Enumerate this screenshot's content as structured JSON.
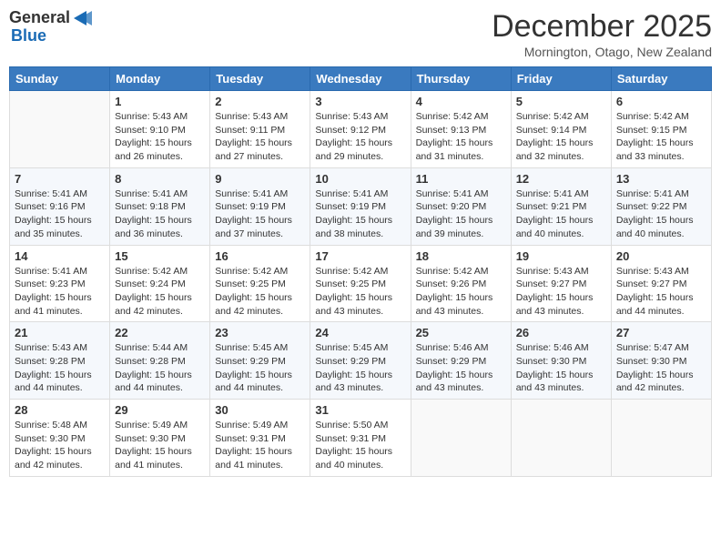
{
  "header": {
    "logo_general": "General",
    "logo_blue": "Blue",
    "month_title": "December 2025",
    "location": "Mornington, Otago, New Zealand"
  },
  "days_of_week": [
    "Sunday",
    "Monday",
    "Tuesday",
    "Wednesday",
    "Thursday",
    "Friday",
    "Saturday"
  ],
  "weeks": [
    [
      {
        "day": "",
        "info": ""
      },
      {
        "day": "1",
        "info": "Sunrise: 5:43 AM\nSunset: 9:10 PM\nDaylight: 15 hours\nand 26 minutes."
      },
      {
        "day": "2",
        "info": "Sunrise: 5:43 AM\nSunset: 9:11 PM\nDaylight: 15 hours\nand 27 minutes."
      },
      {
        "day": "3",
        "info": "Sunrise: 5:43 AM\nSunset: 9:12 PM\nDaylight: 15 hours\nand 29 minutes."
      },
      {
        "day": "4",
        "info": "Sunrise: 5:42 AM\nSunset: 9:13 PM\nDaylight: 15 hours\nand 31 minutes."
      },
      {
        "day": "5",
        "info": "Sunrise: 5:42 AM\nSunset: 9:14 PM\nDaylight: 15 hours\nand 32 minutes."
      },
      {
        "day": "6",
        "info": "Sunrise: 5:42 AM\nSunset: 9:15 PM\nDaylight: 15 hours\nand 33 minutes."
      }
    ],
    [
      {
        "day": "7",
        "info": "Sunrise: 5:41 AM\nSunset: 9:16 PM\nDaylight: 15 hours\nand 35 minutes."
      },
      {
        "day": "8",
        "info": "Sunrise: 5:41 AM\nSunset: 9:18 PM\nDaylight: 15 hours\nand 36 minutes."
      },
      {
        "day": "9",
        "info": "Sunrise: 5:41 AM\nSunset: 9:19 PM\nDaylight: 15 hours\nand 37 minutes."
      },
      {
        "day": "10",
        "info": "Sunrise: 5:41 AM\nSunset: 9:19 PM\nDaylight: 15 hours\nand 38 minutes."
      },
      {
        "day": "11",
        "info": "Sunrise: 5:41 AM\nSunset: 9:20 PM\nDaylight: 15 hours\nand 39 minutes."
      },
      {
        "day": "12",
        "info": "Sunrise: 5:41 AM\nSunset: 9:21 PM\nDaylight: 15 hours\nand 40 minutes."
      },
      {
        "day": "13",
        "info": "Sunrise: 5:41 AM\nSunset: 9:22 PM\nDaylight: 15 hours\nand 40 minutes."
      }
    ],
    [
      {
        "day": "14",
        "info": "Sunrise: 5:41 AM\nSunset: 9:23 PM\nDaylight: 15 hours\nand 41 minutes."
      },
      {
        "day": "15",
        "info": "Sunrise: 5:42 AM\nSunset: 9:24 PM\nDaylight: 15 hours\nand 42 minutes."
      },
      {
        "day": "16",
        "info": "Sunrise: 5:42 AM\nSunset: 9:25 PM\nDaylight: 15 hours\nand 42 minutes."
      },
      {
        "day": "17",
        "info": "Sunrise: 5:42 AM\nSunset: 9:25 PM\nDaylight: 15 hours\nand 43 minutes."
      },
      {
        "day": "18",
        "info": "Sunrise: 5:42 AM\nSunset: 9:26 PM\nDaylight: 15 hours\nand 43 minutes."
      },
      {
        "day": "19",
        "info": "Sunrise: 5:43 AM\nSunset: 9:27 PM\nDaylight: 15 hours\nand 43 minutes."
      },
      {
        "day": "20",
        "info": "Sunrise: 5:43 AM\nSunset: 9:27 PM\nDaylight: 15 hours\nand 44 minutes."
      }
    ],
    [
      {
        "day": "21",
        "info": "Sunrise: 5:43 AM\nSunset: 9:28 PM\nDaylight: 15 hours\nand 44 minutes."
      },
      {
        "day": "22",
        "info": "Sunrise: 5:44 AM\nSunset: 9:28 PM\nDaylight: 15 hours\nand 44 minutes."
      },
      {
        "day": "23",
        "info": "Sunrise: 5:45 AM\nSunset: 9:29 PM\nDaylight: 15 hours\nand 44 minutes."
      },
      {
        "day": "24",
        "info": "Sunrise: 5:45 AM\nSunset: 9:29 PM\nDaylight: 15 hours\nand 43 minutes."
      },
      {
        "day": "25",
        "info": "Sunrise: 5:46 AM\nSunset: 9:29 PM\nDaylight: 15 hours\nand 43 minutes."
      },
      {
        "day": "26",
        "info": "Sunrise: 5:46 AM\nSunset: 9:30 PM\nDaylight: 15 hours\nand 43 minutes."
      },
      {
        "day": "27",
        "info": "Sunrise: 5:47 AM\nSunset: 9:30 PM\nDaylight: 15 hours\nand 42 minutes."
      }
    ],
    [
      {
        "day": "28",
        "info": "Sunrise: 5:48 AM\nSunset: 9:30 PM\nDaylight: 15 hours\nand 42 minutes."
      },
      {
        "day": "29",
        "info": "Sunrise: 5:49 AM\nSunset: 9:30 PM\nDaylight: 15 hours\nand 41 minutes."
      },
      {
        "day": "30",
        "info": "Sunrise: 5:49 AM\nSunset: 9:31 PM\nDaylight: 15 hours\nand 41 minutes."
      },
      {
        "day": "31",
        "info": "Sunrise: 5:50 AM\nSunset: 9:31 PM\nDaylight: 15 hours\nand 40 minutes."
      },
      {
        "day": "",
        "info": ""
      },
      {
        "day": "",
        "info": ""
      },
      {
        "day": "",
        "info": ""
      }
    ]
  ]
}
